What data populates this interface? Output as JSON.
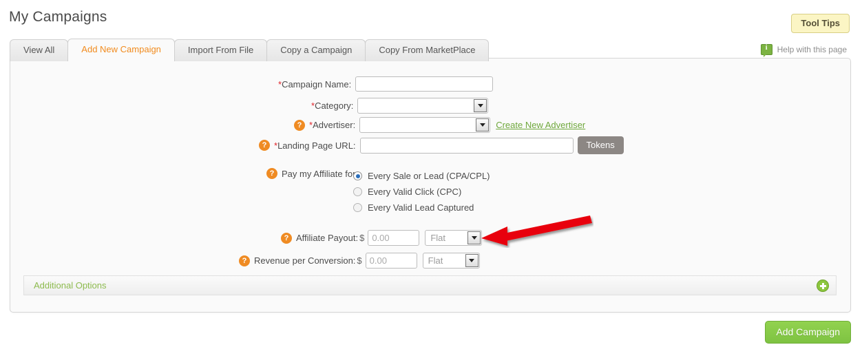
{
  "header": {
    "title": "My Campaigns",
    "tooltips_label": "Tool Tips",
    "help_label": "Help with this page",
    "help_icon": "info-bubble-icon"
  },
  "tabs": [
    {
      "label": "View All",
      "active": false
    },
    {
      "label": "Add New Campaign",
      "active": true
    },
    {
      "label": "Import From File",
      "active": false
    },
    {
      "label": "Copy a Campaign",
      "active": false
    },
    {
      "label": "Copy From MarketPlace",
      "active": false
    }
  ],
  "form": {
    "campaign_name": {
      "label_required": "*",
      "label": "Campaign Name:",
      "value": "",
      "placeholder": ""
    },
    "category": {
      "label_required": "*",
      "label": "Category:",
      "value": ""
    },
    "advertiser": {
      "help_icon": "question-mark-icon",
      "label_required": "*",
      "label": "Advertiser:",
      "value": "",
      "create_link": "Create New Advertiser"
    },
    "landing_page_url": {
      "help_icon": "question-mark-icon",
      "label_required": "*",
      "label": "Landing Page URL:",
      "value": "",
      "tokens_label": "Tokens"
    },
    "pay_affiliate": {
      "help_icon": "question-mark-icon",
      "label": "Pay my Affiliate for:",
      "options": [
        {
          "label": "Every Sale or Lead (CPA/CPL)",
          "checked": true
        },
        {
          "label": "Every Valid Click (CPC)",
          "checked": false
        },
        {
          "label": "Every Valid Lead Captured",
          "checked": false
        }
      ]
    },
    "affiliate_payout": {
      "help_icon": "question-mark-icon",
      "label": "Affiliate Payout:",
      "currency": "$",
      "value": "",
      "placeholder": "0.00",
      "type_value": "Flat"
    },
    "revenue_per_conversion": {
      "help_icon": "question-mark-icon",
      "label": "Revenue per Conversion:",
      "currency": "$",
      "value": "",
      "placeholder": "0.00",
      "type_value": "Flat"
    },
    "additional_options": {
      "label": "Additional Options",
      "expand_icon": "plus-circle-icon"
    },
    "submit_label": "Add Campaign"
  },
  "annotation": {
    "arrow_color": "#e8060a",
    "arrow_direction": "points-left-to-affiliate-payout-type-dropdown"
  },
  "colors": {
    "accent_orange": "#f18b1e",
    "help_icon_orange": "#ef8b23",
    "required_red": "#e0242b",
    "link_green": "#6fa83c",
    "button_green": "#8cc63e",
    "tooltip_yellow": "#fbf5c4",
    "panel_bg": "#fafafa"
  }
}
